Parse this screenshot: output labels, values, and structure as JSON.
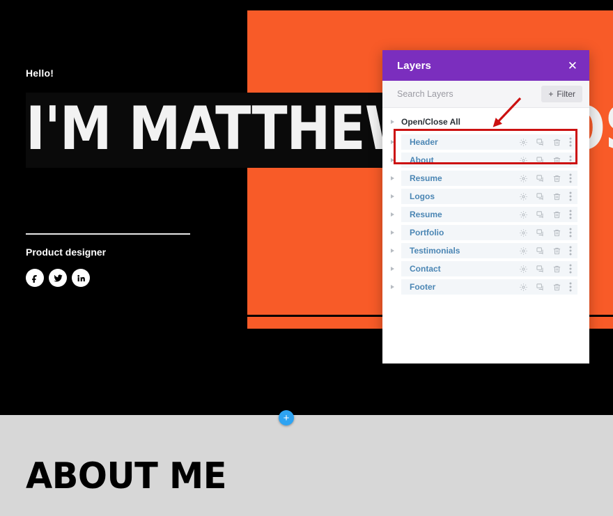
{
  "page": {
    "hero": {
      "greeting": "Hello!",
      "title": "I'M MATTHEW MATOS",
      "role": "Product designer",
      "socials": [
        {
          "name": "facebook-icon",
          "label": "Facebook"
        },
        {
          "name": "twitter-icon",
          "label": "Twitter"
        },
        {
          "name": "linkedin-icon",
          "label": "LinkedIn"
        }
      ]
    },
    "about": {
      "title": "ABOUT ME"
    },
    "add_section_button": {
      "label": "+",
      "icon": "plus-icon",
      "color": "#2ea3f2"
    },
    "colors": {
      "background": "#000000",
      "accent_orange": "#f85b28",
      "about_background": "#d7d7d7"
    }
  },
  "layers_panel": {
    "title": "Layers",
    "close_label": "✕",
    "close_icon": "close-icon",
    "header_color": "#7b2ebe",
    "search": {
      "placeholder": "Search Layers",
      "value": ""
    },
    "filter": {
      "label": "Filter",
      "plus": "+"
    },
    "open_close_all": {
      "label": "Open/Close All"
    },
    "row_actions": [
      {
        "name": "settings-gear-icon",
        "label": "Settings"
      },
      {
        "name": "duplicate-icon",
        "label": "Duplicate"
      },
      {
        "name": "trash-icon",
        "label": "Delete"
      },
      {
        "name": "more-options-icon",
        "label": "More options"
      }
    ],
    "layers": [
      {
        "label": "Header"
      },
      {
        "label": "About"
      },
      {
        "label": "Resume"
      },
      {
        "label": "Logos"
      },
      {
        "label": "Resume"
      },
      {
        "label": "Portfolio"
      },
      {
        "label": "Testimonials"
      },
      {
        "label": "Contact"
      },
      {
        "label": "Footer"
      }
    ]
  },
  "annotations": {
    "highlight_box": {
      "color": "#cc1111",
      "targets": "Header, About"
    },
    "arrow": {
      "color": "#cc1111",
      "direction": "down-left"
    }
  }
}
